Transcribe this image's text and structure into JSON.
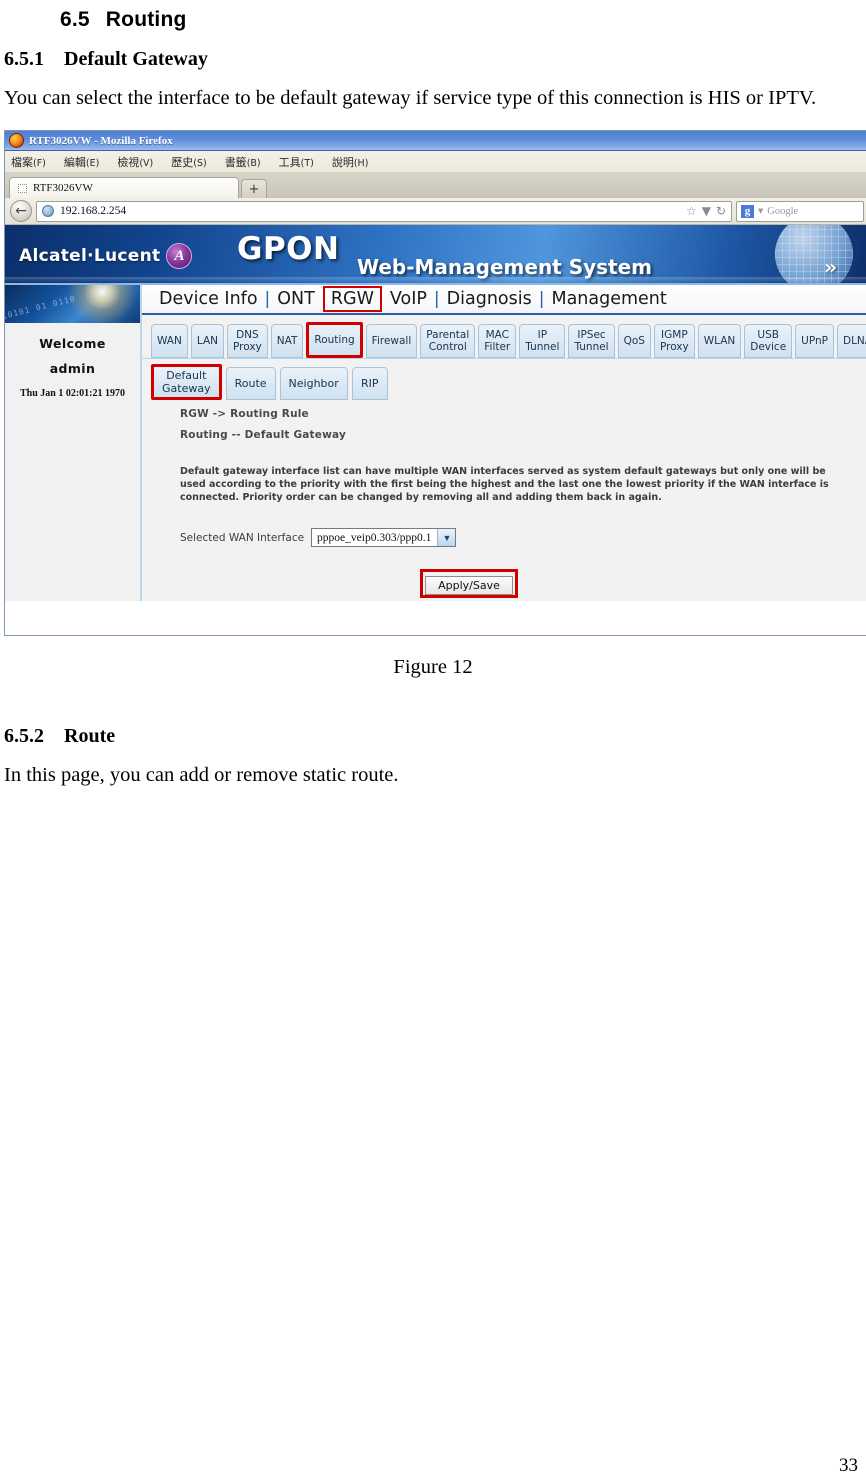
{
  "document": {
    "section_heading": {
      "number": "6.5",
      "title": "Routing"
    },
    "subsection_1": {
      "number": "6.5.1",
      "title": "Default Gateway"
    },
    "paragraph_1": "You can select the interface to be default gateway if service type of this connection is HIS or IPTV.",
    "figure_caption": "Figure 12",
    "subsection_2": {
      "number": "6.5.2",
      "title": "Route"
    },
    "paragraph_2": "In this page, you can add or remove static route.",
    "page_number": "33"
  },
  "browser": {
    "window_title": "RTF3026VW - Mozilla Firefox",
    "menu_items": [
      {
        "label": "檔案",
        "mnemonic": "(F)"
      },
      {
        "label": "編輯",
        "mnemonic": "(E)"
      },
      {
        "label": "檢視",
        "mnemonic": "(V)"
      },
      {
        "label": "歷史",
        "mnemonic": "(S)"
      },
      {
        "label": "書籤",
        "mnemonic": "(B)"
      },
      {
        "label": "工具",
        "mnemonic": "(T)"
      },
      {
        "label": "說明",
        "mnemonic": "(H)"
      }
    ],
    "tab_title": "RTF3026VW",
    "new_tab_label": "+",
    "back_arrow": "←",
    "url": "192.168.2.254",
    "bookmark_star": "☆",
    "dropdown_marker": "▼",
    "reload_icon": "↻",
    "search_engine_badge": "g",
    "search_engine_name": "Google",
    "search_caret": "▾"
  },
  "banner": {
    "brand": "Alcatel·Lucent",
    "brand_mark": "A",
    "product": "GPON",
    "subtitle": "Web-Management System",
    "swoosh": "»"
  },
  "sidebar": {
    "welcome": "Welcome",
    "username": "admin",
    "datetime": "Thu Jan 1 02:01:21 1970"
  },
  "topnav": {
    "items": [
      {
        "label": "Device Info",
        "selected": false
      },
      {
        "label": "ONT",
        "selected": false
      },
      {
        "label": "RGW",
        "selected": true
      },
      {
        "label": "VoIP",
        "selected": false
      },
      {
        "label": "Diagnosis",
        "selected": false
      },
      {
        "label": "Management",
        "selected": false
      }
    ],
    "separator": "|"
  },
  "tabs": [
    {
      "line1": "WAN",
      "line2": "",
      "selected": false
    },
    {
      "line1": "LAN",
      "line2": "",
      "selected": false
    },
    {
      "line1": "DNS",
      "line2": "Proxy",
      "selected": false
    },
    {
      "line1": "NAT",
      "line2": "",
      "selected": false
    },
    {
      "line1": "Routing",
      "line2": "",
      "selected": true
    },
    {
      "line1": "Firewall",
      "line2": "",
      "selected": false
    },
    {
      "line1": "Parental",
      "line2": "Control",
      "selected": false
    },
    {
      "line1": "MAC",
      "line2": "Filter",
      "selected": false
    },
    {
      "line1": "IP",
      "line2": "Tunnel",
      "selected": false
    },
    {
      "line1": "IPSec",
      "line2": "Tunnel",
      "selected": false
    },
    {
      "line1": "QoS",
      "line2": "",
      "selected": false
    },
    {
      "line1": "IGMP",
      "line2": "Proxy",
      "selected": false
    },
    {
      "line1": "WLAN",
      "line2": "",
      "selected": false
    },
    {
      "line1": "USB",
      "line2": "Device",
      "selected": false
    },
    {
      "line1": "UPnP",
      "line2": "",
      "selected": false
    },
    {
      "line1": "DLNA",
      "line2": "",
      "selected": false
    }
  ],
  "subtabs": [
    {
      "line1": "Default",
      "line2": "Gateway",
      "selected": true
    },
    {
      "line1": "Route",
      "line2": "",
      "selected": false
    },
    {
      "line1": "Neighbor",
      "line2": "",
      "selected": false
    },
    {
      "line1": "RIP",
      "line2": "",
      "selected": false
    }
  ],
  "panel": {
    "breadcrumb_1": "RGW -> Routing Rule",
    "breadcrumb_2": "Routing -- Default Gateway",
    "description": "Default gateway interface list can have multiple WAN interfaces served as system default gateways but only one will be used according to the priority with the first being the highest and the last one the lowest priority if the WAN interface is connected. Priority order can be changed by removing all and adding them back in again.",
    "select_label": "Selected WAN Interface",
    "select_value": "pppoe_veip0.303/ppp0.1",
    "select_caret": "▼",
    "apply_button": "Apply/Save"
  },
  "colors": {
    "highlight_red": "#d00000",
    "banner_blue": "#2f73c4",
    "nav_border": "#2a5fa8"
  }
}
